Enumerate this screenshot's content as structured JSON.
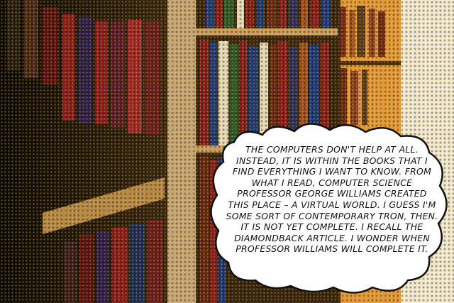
{
  "caption": {
    "text": "THE COMPUTERS DON'T HELP AT ALL. INSTEAD, IT IS WITHIN THE BOOKS THAT I FIND EVERYTHING I WANT TO KNOW. FROM WHAT I READ, COMPUTER SCIENCE PROFESSOR GEORGE WILLIAMS CREATED THIS PLACE – A VIRTUAL WORLD. I GUESS I'M SOME SORT OF CONTEMPORARY TRON, THEN. IT IS NOT YET COMPLETE. I RECALL THE DIAMONDBACK ARTICLE. I WONDER WHEN PROFESSOR WILLIAMS WILL COMPLETE IT."
  },
  "colors": {
    "shelf_dark": "#1a1208",
    "wood": "#6b4a1e",
    "wall_warm": "#e8a040",
    "light_window": "#f4ecd8",
    "bubble": "#ffffff",
    "bubble_outline": "#111111",
    "book_red": "#8a1e1e",
    "book_blue": "#1e3a7a",
    "book_green": "#2e5a2a",
    "book_cream": "#e6dcc0"
  }
}
